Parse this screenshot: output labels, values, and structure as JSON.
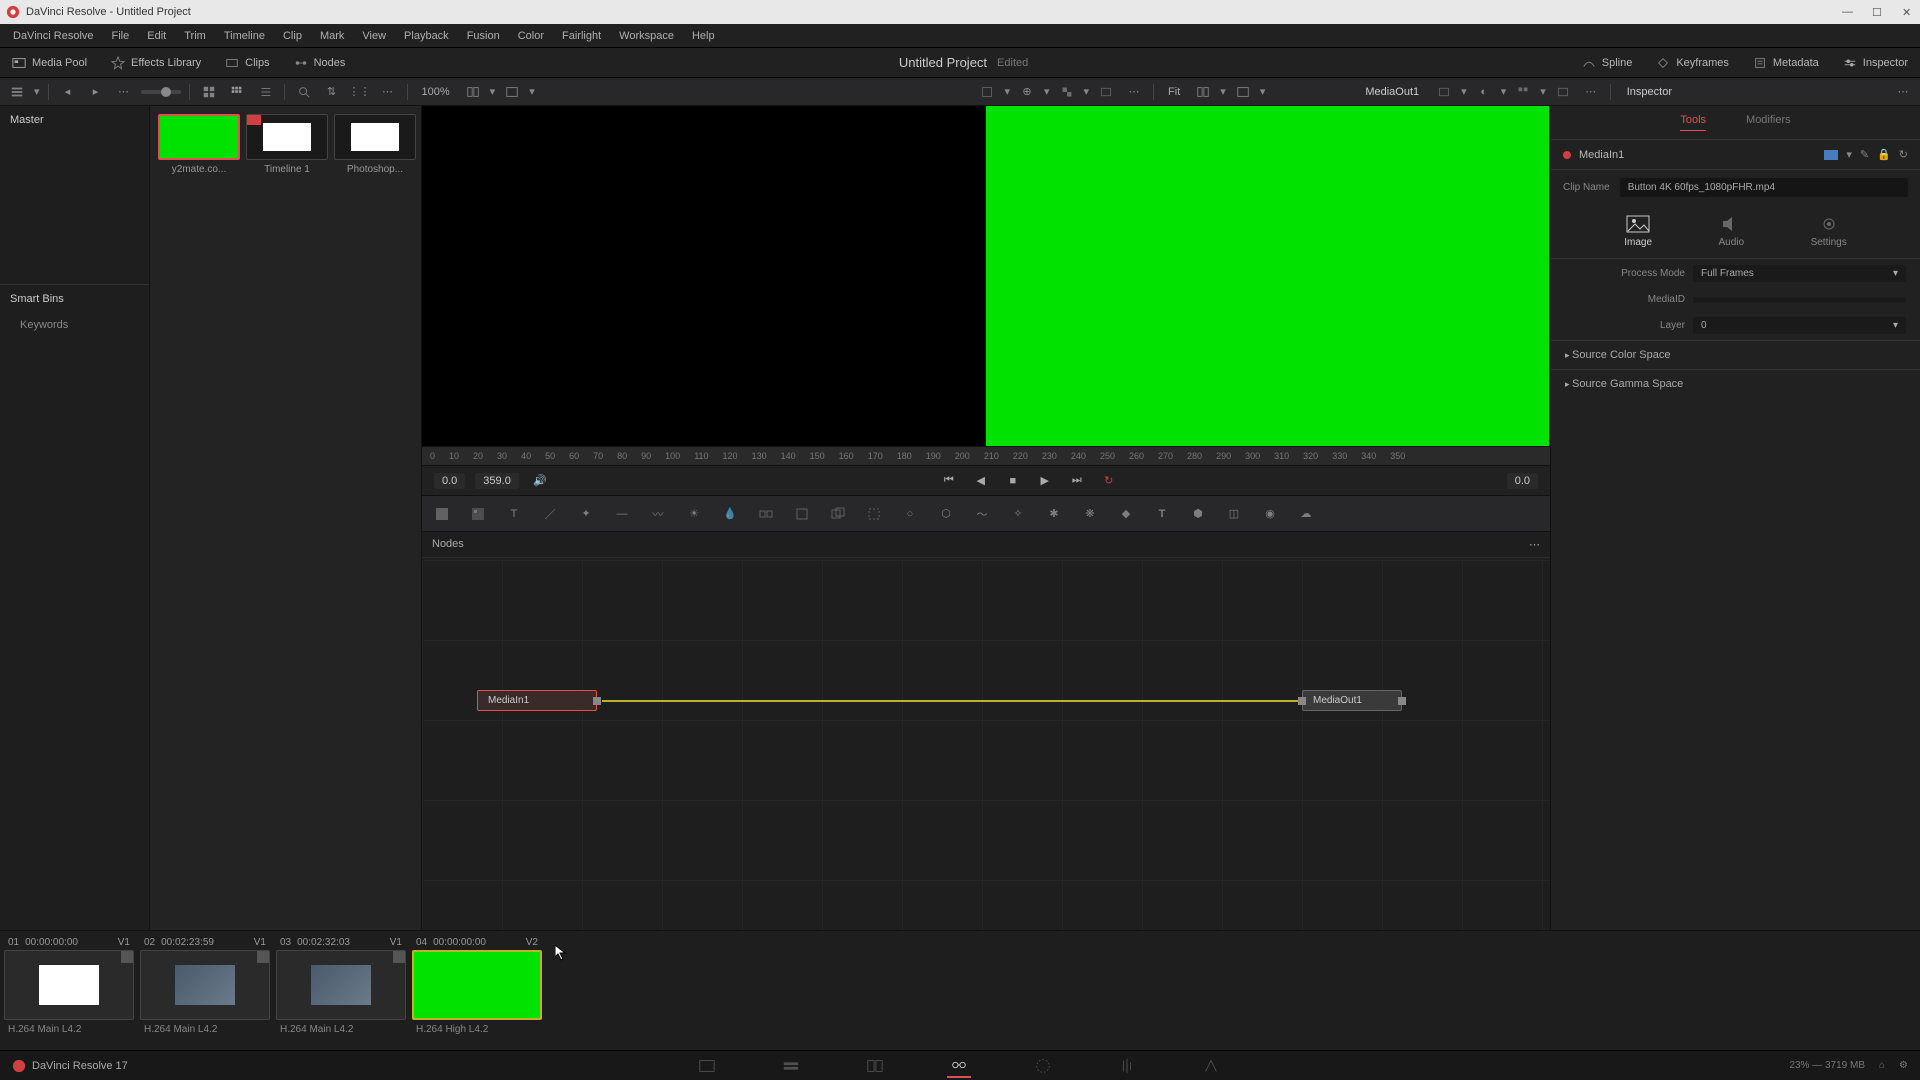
{
  "window": {
    "title": "DaVinci Resolve - Untitled Project"
  },
  "menu": {
    "items": [
      "DaVinci Resolve",
      "File",
      "Edit",
      "Trim",
      "Timeline",
      "Clip",
      "Mark",
      "View",
      "Playback",
      "Fusion",
      "Color",
      "Fairlight",
      "Workspace",
      "Help"
    ]
  },
  "toptool": {
    "mediapool": "Media Pool",
    "effects": "Effects Library",
    "clips": "Clips",
    "nodes": "Nodes",
    "project": "Untitled Project",
    "edited": "Edited",
    "spline": "Spline",
    "keyframes": "Keyframes",
    "metadata": "Metadata",
    "inspector": "Inspector"
  },
  "sectool": {
    "zoom": "100%",
    "fit": "Fit",
    "viewer_out": "MediaOut1"
  },
  "sidebar": {
    "master": "Master",
    "smartbins": "Smart Bins",
    "keywords": "Keywords"
  },
  "pool": {
    "clips": [
      {
        "name": "y2mate.co...",
        "kind": "green"
      },
      {
        "name": "Timeline 1",
        "kind": "tl"
      },
      {
        "name": "Photoshop...",
        "kind": "tl"
      }
    ]
  },
  "transport": {
    "start": "0.0",
    "end": "359.0",
    "right": "0.0"
  },
  "ruler_ticks": [
    "0",
    "10",
    "20",
    "30",
    "40",
    "50",
    "60",
    "70",
    "80",
    "90",
    "100",
    "110",
    "120",
    "130",
    "140",
    "150",
    "160",
    "170",
    "180",
    "190",
    "200",
    "210",
    "220",
    "230",
    "240",
    "250",
    "260",
    "270",
    "280",
    "290",
    "300",
    "310",
    "320",
    "330",
    "340",
    "350"
  ],
  "nodes": {
    "title": "Nodes",
    "in": "MediaIn1",
    "out": "MediaOut1"
  },
  "inspector": {
    "title": "Inspector",
    "tabs": {
      "tools": "Tools",
      "modifiers": "Modifiers"
    },
    "node": "MediaIn1",
    "clipname_lbl": "Clip Name",
    "clipname": "Button 4K 60fps_1080pFHR.mp4",
    "subtabs": {
      "image": "Image",
      "audio": "Audio",
      "settings": "Settings"
    },
    "process_lbl": "Process Mode",
    "process_val": "Full Frames",
    "mediaid_lbl": "MediaID",
    "layer_lbl": "Layer",
    "layer_val": "0",
    "src_color": "Source Color Space",
    "src_gamma": "Source Gamma Space"
  },
  "clipstrip": {
    "items": [
      {
        "num": "01",
        "tc": "00:00:00:00",
        "trk": "V1",
        "codec": "H.264 Main L4.2",
        "kind": "white"
      },
      {
        "num": "02",
        "tc": "00:02:23:59",
        "trk": "V1",
        "codec": "H.264 Main L4.2",
        "kind": "img"
      },
      {
        "num": "03",
        "tc": "00:02:32:03",
        "trk": "V1",
        "codec": "H.264 Main L4.2",
        "kind": "img"
      },
      {
        "num": "04",
        "tc": "00:00:00:00",
        "trk": "V2",
        "codec": "H.264 High L4.2",
        "kind": "green"
      }
    ]
  },
  "bottom": {
    "app": "DaVinci Resolve 17",
    "status": "23% — 3719 MB"
  }
}
